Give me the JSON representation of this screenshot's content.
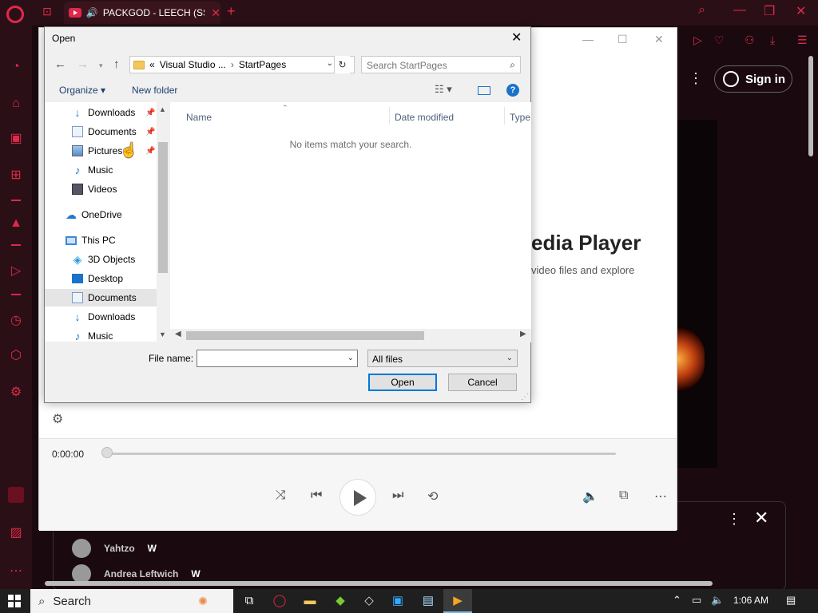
{
  "browser": {
    "tab_title": "PACKGOD - LEECH (SSS",
    "tab_close": "✕",
    "new_tab": "+",
    "minimize": "—",
    "restore": "❐",
    "close": "✕"
  },
  "webpage": {
    "sign_in": "Sign in",
    "chat": [
      {
        "name": "Yahtzo",
        "msg": "W"
      },
      {
        "name": "Andrea Leftwich",
        "msg": "W"
      }
    ]
  },
  "media_player": {
    "title_partial": "edia Player",
    "subtitle_partial": "video files and explore",
    "time": "0:00:00"
  },
  "dialog": {
    "title": "Open",
    "breadcrumb_prefix": "«",
    "breadcrumb": [
      "Visual Studio ...",
      "StartPages"
    ],
    "breadcrumb_sep": "›",
    "search_placeholder": "Search StartPages",
    "organize": "Organize ▾",
    "new_folder": "New folder",
    "help": "?",
    "nav_items": [
      {
        "label": "Downloads",
        "icon": "downloads-icon",
        "pinned": true
      },
      {
        "label": "Documents",
        "icon": "documents-icon",
        "pinned": true
      },
      {
        "label": "Pictures",
        "icon": "pictures-icon",
        "pinned": true
      },
      {
        "label": "Music",
        "icon": "music-icon",
        "pinned": false
      },
      {
        "label": "Videos",
        "icon": "videos-icon",
        "pinned": false
      },
      {
        "label": "OneDrive",
        "icon": "onedrive-icon",
        "pinned": false
      },
      {
        "label": "This PC",
        "icon": "this-pc-icon",
        "pinned": false
      },
      {
        "label": "3D Objects",
        "icon": "3d-objects-icon",
        "pinned": false
      },
      {
        "label": "Desktop",
        "icon": "desktop-icon",
        "pinned": false
      },
      {
        "label": "Documents",
        "icon": "documents-icon",
        "pinned": false,
        "selected": true
      },
      {
        "label": "Downloads",
        "icon": "downloads-icon",
        "pinned": false
      },
      {
        "label": "Music",
        "icon": "music-icon",
        "pinned": false
      }
    ],
    "columns": [
      "Name",
      "Date modified",
      "Type"
    ],
    "empty_message": "No items match your search.",
    "file_name_label": "File name:",
    "file_name_value": "",
    "file_type": "All files",
    "open_button": "Open",
    "cancel_button": "Cancel"
  },
  "taskbar": {
    "search_label": "Search",
    "time": "1:06 AM"
  },
  "colors": {
    "opera_red": "#e0284a",
    "dialog_bg": "#f0f0f0",
    "accent_blue": "#0078d7"
  }
}
